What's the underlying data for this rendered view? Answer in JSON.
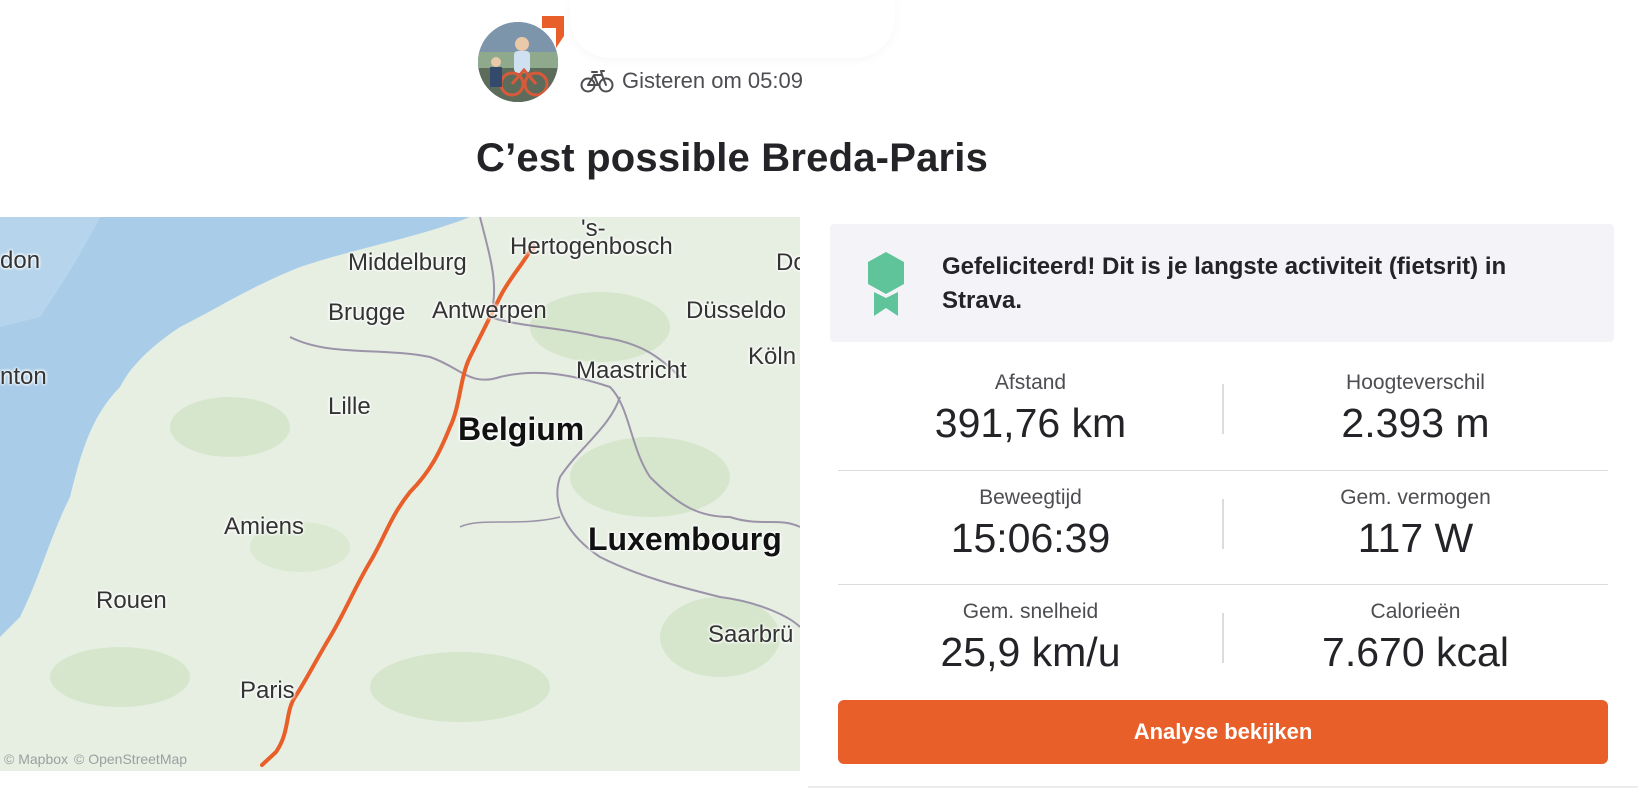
{
  "header": {
    "activity_icon": "bike-icon",
    "timestamp": "Gisteren om 05:09",
    "title": "C’est possible Breda-Paris"
  },
  "map": {
    "labels": {
      "hertogenbosch_top": "'s-",
      "hertogenbosch": "Hertogenbosch",
      "london_partial": "don",
      "middelburg": "Middelburg",
      "do_partial": "Do",
      "brugge": "Brugge",
      "antwerpen": "Antwerpen",
      "dusseldorf_partial": "Düsseldo",
      "maastricht": "Maastricht",
      "koln": "Köln",
      "nton_partial": "nton",
      "lille": "Lille",
      "belgium": "Belgium",
      "amiens": "Amiens",
      "luxembourg": "Luxembourg",
      "rouen": "Rouen",
      "saarbrucken_partial": "Saarbrü",
      "paris": "Paris"
    },
    "attribution": [
      "© Mapbox",
      "© OpenStreetMap"
    ],
    "route_color": "#e85f29"
  },
  "achievement": {
    "icon": "medal-icon",
    "message": "Gefeliciteerd! Dit is je langste activiteit (fietsrit) in Strava."
  },
  "stats": {
    "distance": {
      "label": "Afstand",
      "value": "391,76 km"
    },
    "elevation": {
      "label": "Hoogteverschil",
      "value": "2.393 m"
    },
    "moving_time": {
      "label": "Beweegtijd",
      "value": "15:06:39"
    },
    "avg_power": {
      "label": "Gem. vermogen",
      "value": "117 W"
    },
    "avg_speed": {
      "label": "Gem. snelheid",
      "value": "25,9 km/u"
    },
    "calories": {
      "label": "Calorieën",
      "value": "7.670 kcal"
    }
  },
  "actions": {
    "analyse_label": "Analyse bekijken"
  },
  "colors": {
    "accent": "#e85f29",
    "medal": "#5fc49a"
  }
}
